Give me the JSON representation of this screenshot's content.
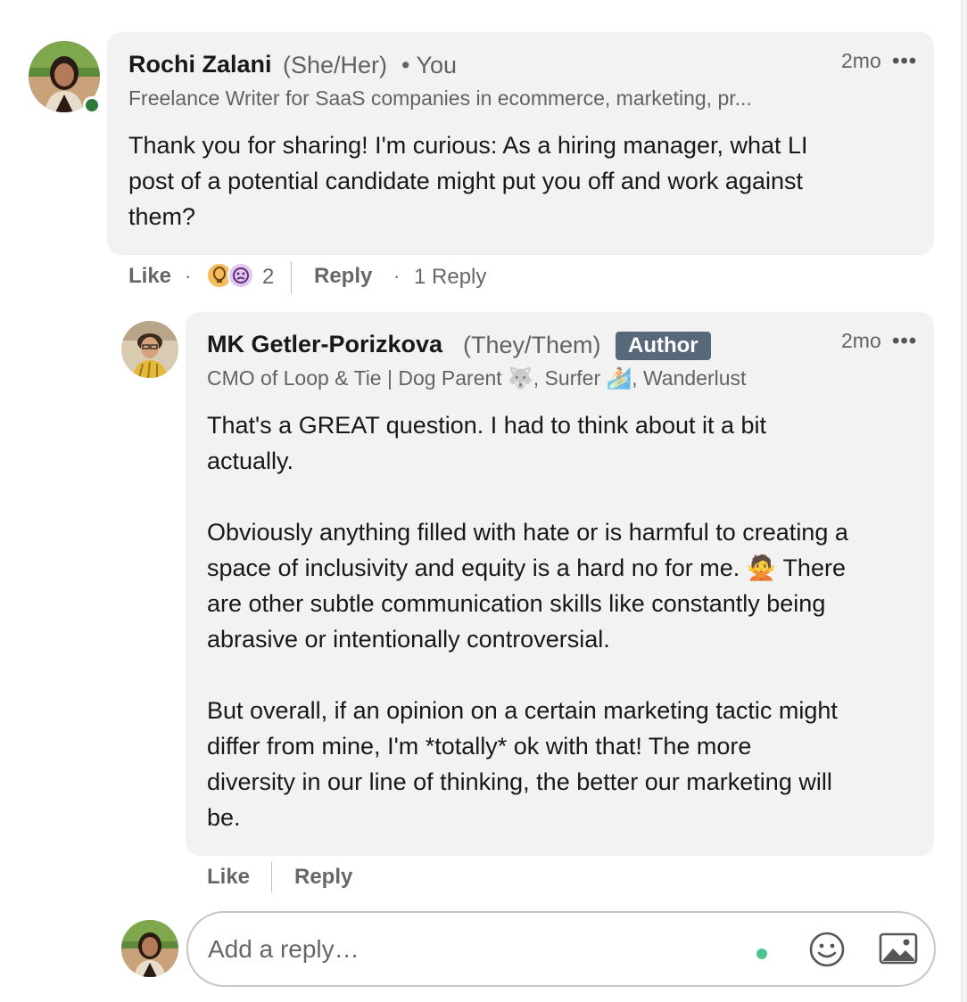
{
  "comments": [
    {
      "author": "Rochi Zalani",
      "pronouns": "(She/Her)",
      "you_label": "• You",
      "headline": "Freelance Writer for SaaS companies in ecommerce, marketing, pr...",
      "time": "2mo",
      "more": "•••",
      "body": [
        "Thank you for sharing! I'm curious: As a hiring manager, what LI",
        "post of a potential candidate might put you off and work against",
        "them?"
      ],
      "actions": {
        "like": "Like",
        "sep1": "·",
        "reaction_count": "2",
        "reply": "Reply",
        "sep2": "·",
        "reply_count": "1 Reply"
      },
      "reactions": [
        "lightbulb-insightful-icon",
        "thinking-curious-icon"
      ],
      "online_status_color": "#2f7a3b"
    },
    {
      "author": "MK Getler-Porizkova",
      "pronouns": "(They/Them)",
      "badge": "Author",
      "headline": "CMO of Loop & Tie | Dog Parent 🐺, Surfer 🏄, Wanderlust",
      "time": "2mo",
      "more": "•••",
      "body": [
        "That's a GREAT question. I had to think about it a bit",
        "actually.",
        "",
        "Obviously anything filled with hate or is harmful to creating a",
        "space of inclusivity and equity is a hard no for me. 🙅 There",
        "are other subtle communication skills like constantly being",
        "abrasive or intentionally controversial.",
        "",
        "But overall, if an opinion on a certain marketing tactic might",
        "differ from mine, I'm *totally* ok with that! The more",
        "diversity in our line of thinking, the better our marketing will",
        "be."
      ],
      "actions": {
        "like": "Like",
        "reply": "Reply"
      }
    }
  ],
  "composer": {
    "placeholder": "Add a reply…",
    "icons": [
      "emoji-icon",
      "image-icon"
    ],
    "typing_indicator_color": "#4ec38d"
  },
  "colors": {
    "bubble": "#f2f2f2",
    "badge": "#56687a",
    "text_secondary": "rgba(0,0,0,0.6)"
  }
}
